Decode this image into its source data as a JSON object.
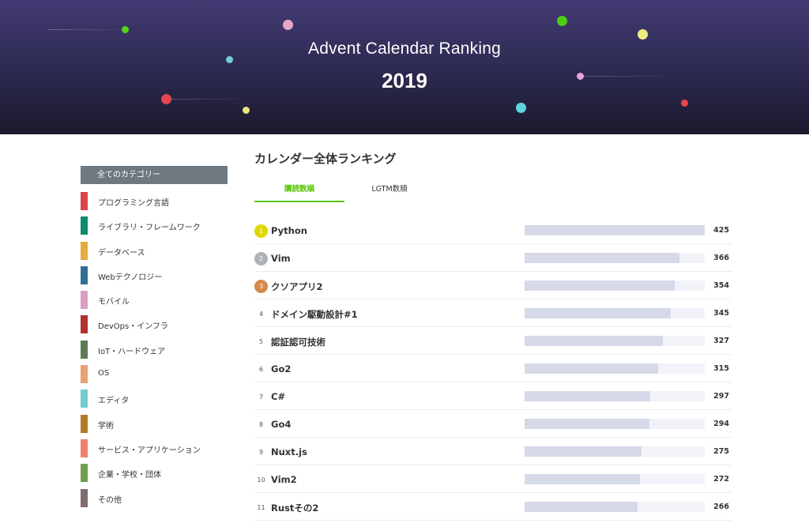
{
  "hero": {
    "title": "Advent Calendar Ranking",
    "year": "2019"
  },
  "sidebar": {
    "all_label": "全てのカテゴリー",
    "categories": [
      {
        "label": "プログラミング言語",
        "color": "#e0424e"
      },
      {
        "label": "ライブラリ・フレームワーク",
        "color": "#0e8a6c"
      },
      {
        "label": "データベース",
        "color": "#e8a93e"
      },
      {
        "label": "Webテクノロジー",
        "color": "#2f6f93"
      },
      {
        "label": "モバイル",
        "color": "#d9a0c4"
      },
      {
        "label": "DevOps・インフラ",
        "color": "#b3302e"
      },
      {
        "label": "IoT・ハードウェア",
        "color": "#5d7a55"
      },
      {
        "label": "OS",
        "color": "#eaa272"
      },
      {
        "label": "エディタ",
        "color": "#6fcfcf"
      },
      {
        "label": "学術",
        "color": "#b27a24"
      },
      {
        "label": "サービス・アプリケーション",
        "color": "#ee8070"
      },
      {
        "label": "企業・学校・団体",
        "color": "#6f9e4c"
      },
      {
        "label": "その他",
        "color": "#806c6c"
      }
    ]
  },
  "main": {
    "section_title": "カレンダー全体ランキング",
    "tabs": [
      {
        "label": "購読数順",
        "active": true
      },
      {
        "label": "LGTM数順",
        "active": false
      }
    ],
    "max_count": 425,
    "rankings": [
      {
        "rank": "1",
        "name": "Python",
        "count": 425,
        "badge_color": "#e1d600"
      },
      {
        "rank": "2",
        "name": "Vim",
        "count": 366,
        "badge_color": "#aeb1b8"
      },
      {
        "rank": "3",
        "name": "クソアプリ2",
        "count": 354,
        "badge_color": "#d38a4a"
      },
      {
        "rank": "4",
        "name": "ドメイン駆動設計#1",
        "count": 345,
        "badge_color": ""
      },
      {
        "rank": "5",
        "name": "認証認可技術",
        "count": 327,
        "badge_color": ""
      },
      {
        "rank": "6",
        "name": "Go2",
        "count": 315,
        "badge_color": ""
      },
      {
        "rank": "7",
        "name": "C#",
        "count": 297,
        "badge_color": ""
      },
      {
        "rank": "8",
        "name": "Go4",
        "count": 294,
        "badge_color": ""
      },
      {
        "rank": "9",
        "name": "Nuxt.js",
        "count": 275,
        "badge_color": ""
      },
      {
        "rank": "10",
        "name": "Vim2",
        "count": 272,
        "badge_color": ""
      },
      {
        "rank": "11",
        "name": "Rustその2",
        "count": 266,
        "badge_color": ""
      }
    ]
  },
  "colors": {
    "accent": "#55c500",
    "hero_top": "#423b73",
    "hero_bottom": "#1b1a2c",
    "bar_fill": "#d6d9e8",
    "bar_track": "#f2f3f9"
  }
}
